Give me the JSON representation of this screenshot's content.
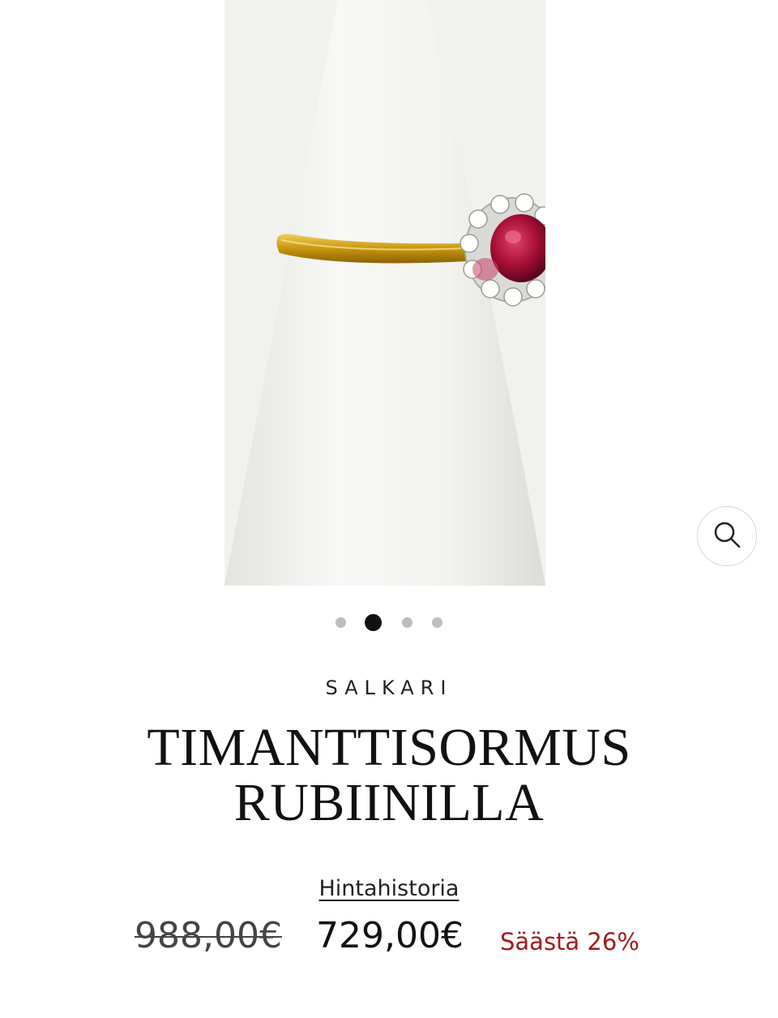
{
  "product": {
    "vendor": "SALKARI",
    "title_line1": "TIMANTTISORMUS",
    "title_line2": "RUBIINILLA",
    "price_history_link": "Hintahistoria",
    "compare_at_price": "988,00€",
    "price": "729,00€",
    "savings": "Säästä 26%"
  },
  "gallery": {
    "image_count": 4,
    "active_index": 1,
    "zoom_icon": "search-icon"
  },
  "colors": {
    "savings_red": "#a21c1c",
    "active_dot": "#111111",
    "inactive_dot": "#bdbdbd",
    "ruby": "#b0123c",
    "gold": "#d4a21a"
  }
}
